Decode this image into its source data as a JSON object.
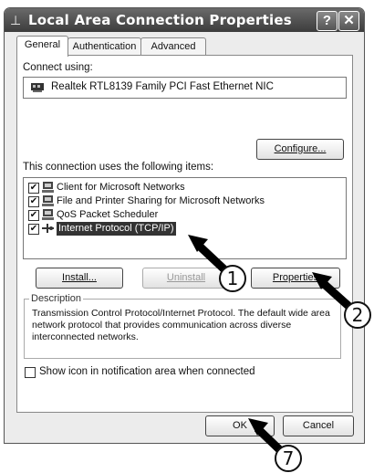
{
  "window": {
    "title": "Local Area Connection Properties",
    "help_label": "?",
    "close_label": "✕"
  },
  "tabs": [
    {
      "label": "General",
      "active": true
    },
    {
      "label": "Authentication",
      "active": false
    },
    {
      "label": "Advanced",
      "active": false
    }
  ],
  "general": {
    "connect_using_label": "Connect using:",
    "adapter_name": "Realtek RTL8139 Family PCI Fast Ethernet NIC",
    "configure_label": "Configure...",
    "items_label": "This connection uses the following items:",
    "items": [
      {
        "label": "Client for Microsoft Networks",
        "checked": true,
        "selected": false
      },
      {
        "label": "File and Printer Sharing for Microsoft Networks",
        "checked": true,
        "selected": false
      },
      {
        "label": "QoS Packet Scheduler",
        "checked": true,
        "selected": false
      },
      {
        "label": "Internet Protocol (TCP/IP)",
        "checked": true,
        "selected": true
      }
    ],
    "install_label": "Install...",
    "uninstall_label": "Uninstall",
    "properties_label": "Properties",
    "description_legend": "Description",
    "description_text": "Transmission Control Protocol/Internet Protocol. The default wide area network protocol that provides communication across diverse interconnected networks.",
    "show_icon_label": "Show icon in notification area when connected",
    "show_icon_checked": false
  },
  "footer": {
    "ok_label": "OK",
    "cancel_label": "Cancel"
  },
  "callouts": [
    "1",
    "2",
    "7"
  ]
}
